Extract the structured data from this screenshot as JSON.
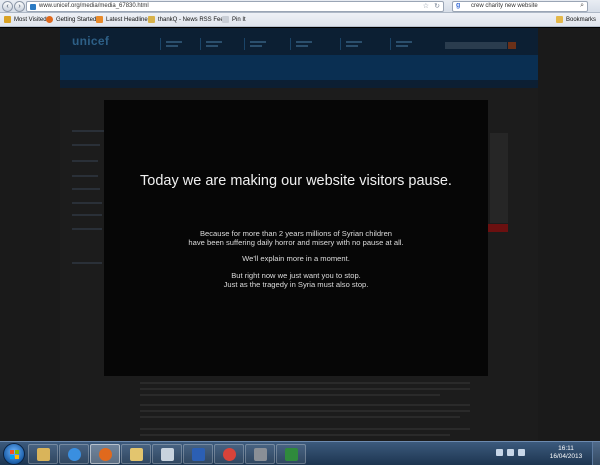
{
  "browser": {
    "url": "www.unicef.org/media/media_67830.html",
    "search_engine": "g",
    "search_query": "crew charity new website",
    "bookmarks": [
      {
        "label": "Most Visited",
        "icon": "star-icon",
        "color": "#d9a224"
      },
      {
        "label": "Getting Started",
        "icon": "firefox-icon",
        "color": "#e0691d"
      },
      {
        "label": "Latest Headlines",
        "icon": "rss-icon",
        "color": "#e88a2a"
      },
      {
        "label": "thankQ - News RSS Feed",
        "icon": "folder-icon",
        "color": "#d8b24a"
      },
      {
        "label": "Pin It",
        "icon": "pin-icon",
        "color": "#c9ced6"
      }
    ],
    "bookmarks_menu": "Bookmarks"
  },
  "page": {
    "logo": "unicef"
  },
  "overlay": {
    "headline": "Today we are making our website visitors pause.",
    "paragraphs": [
      [
        "Because for more than 2 years millions of Syrian children",
        "have been suffering daily horror and misery with no pause at all."
      ],
      [
        "We'll explain more in a moment."
      ],
      [
        "But right now we just want you to stop.",
        "Just as the tragedy in Syria must also stop."
      ]
    ]
  },
  "taskbar": {
    "apps": [
      {
        "name": "folder-app",
        "color": "#d9b45a"
      },
      {
        "name": "ie-app",
        "color": "#3a8fe0"
      },
      {
        "name": "firefox-app",
        "color": "#e0691d",
        "active": true
      },
      {
        "name": "explorer-app",
        "color": "#e3c56e"
      },
      {
        "name": "notes-app",
        "color": "#c8d3de"
      },
      {
        "name": "word-app",
        "color": "#2b5fb4"
      },
      {
        "name": "chrome-app",
        "color": "#d9433a"
      },
      {
        "name": "media-app",
        "color": "#8a8f96"
      },
      {
        "name": "excel-app",
        "color": "#2f8a3c"
      }
    ],
    "clock_time": "16:11",
    "clock_date": "16/04/2013"
  }
}
